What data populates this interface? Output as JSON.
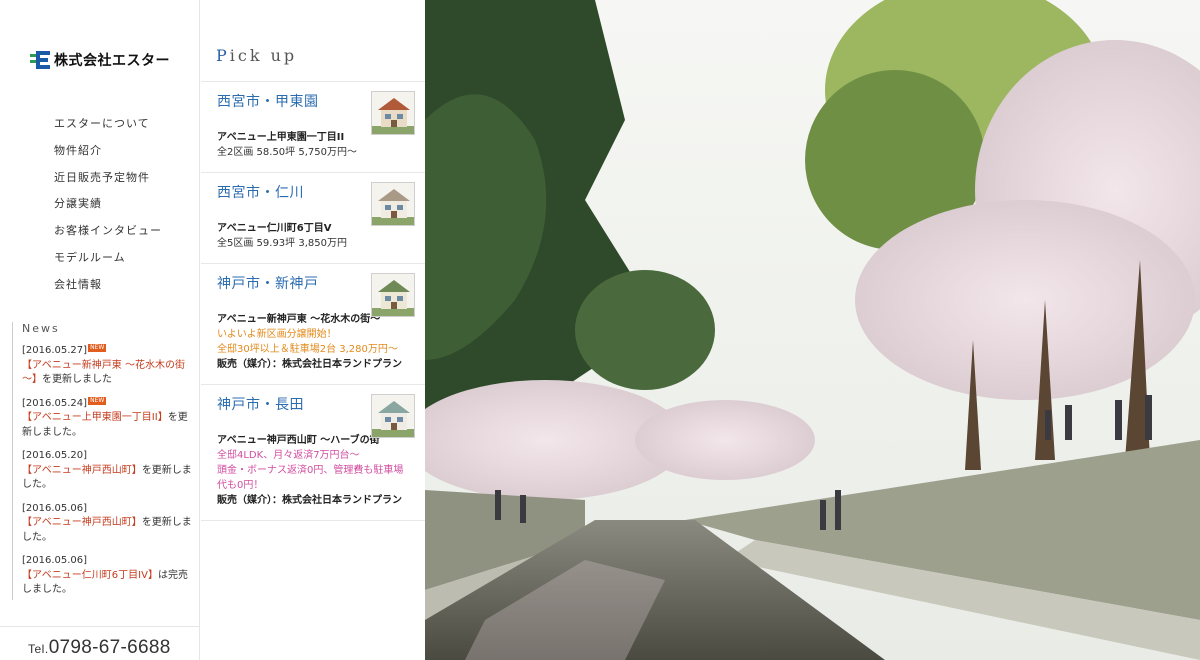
{
  "brand": {
    "name": "株式会社エスター"
  },
  "nav": {
    "items": [
      "エスターについて",
      "物件紹介",
      "近日販売予定物件",
      "分譲実績",
      "お客様インタビュー",
      "モデルルーム",
      "会社情報"
    ]
  },
  "news": {
    "heading": "News",
    "new_badge": "NEW",
    "items": [
      {
        "date": "[2016.05.27]",
        "is_new": true,
        "link": "【アベニュー新神戸東 ～花水木の街～】",
        "suffix": "を更新しました"
      },
      {
        "date": "[2016.05.24]",
        "is_new": true,
        "link": "【アベニュー上甲東園一丁目II】",
        "suffix": "を更新しました。"
      },
      {
        "date": "[2016.05.20]",
        "is_new": false,
        "link": "【アベニュー神戸西山町】",
        "suffix": "を更新しました。"
      },
      {
        "date": "[2016.05.06]",
        "is_new": false,
        "link": "【アベニュー神戸西山町】",
        "suffix": "を更新しました。"
      },
      {
        "date": "[2016.05.06]",
        "is_new": false,
        "link": "【アベニュー仁川町6丁目IV】",
        "suffix": "は完売しました。"
      }
    ]
  },
  "contact": {
    "tel_label": "Tel.",
    "tel_number": "0798-67-6688"
  },
  "pickup": {
    "heading_first": "P",
    "heading_rest": "ick up",
    "cards": [
      {
        "area": "西宮市・甲東園",
        "name": "アベニュー上甲東園一丁目II",
        "lines": [
          {
            "text": "全2区画 58.50坪 5,750万円～",
            "style": "plain"
          }
        ]
      },
      {
        "area": "西宮市・仁川",
        "name": "アベニュー仁川町6丁目V",
        "lines": [
          {
            "text": "全5区画 59.93坪 3,850万円",
            "style": "plain"
          }
        ]
      },
      {
        "area": "神戸市・新神戸",
        "name": "アベニュー新神戸東 ～花水木の街～",
        "lines": [
          {
            "text": "いよいよ新区画分譲開始！",
            "style": "orange"
          },
          {
            "text": "全邸30坪以上＆駐車場2台 3,280万円～",
            "style": "orange"
          },
          {
            "text": "販売（媒介）：株式会社日本ランドプラン",
            "style": "bold"
          }
        ]
      },
      {
        "area": "神戸市・長田",
        "name": "アベニュー神戸西山町 ～ハーブの街",
        "lines": [
          {
            "text": "全邸4LDK、月々返済7万円台～",
            "style": "pink"
          },
          {
            "text": "頭金・ボーナス返済0円、管理費も駐車場代も0円！",
            "style": "pink"
          },
          {
            "text": "販売（媒介）：株式会社日本ランドプラン",
            "style": "bold"
          }
        ]
      }
    ]
  },
  "colors": {
    "accent_blue": "#2b6cb0",
    "news_red": "#c43b1d",
    "orange": "#e38a1a",
    "pink": "#d24ea0"
  }
}
